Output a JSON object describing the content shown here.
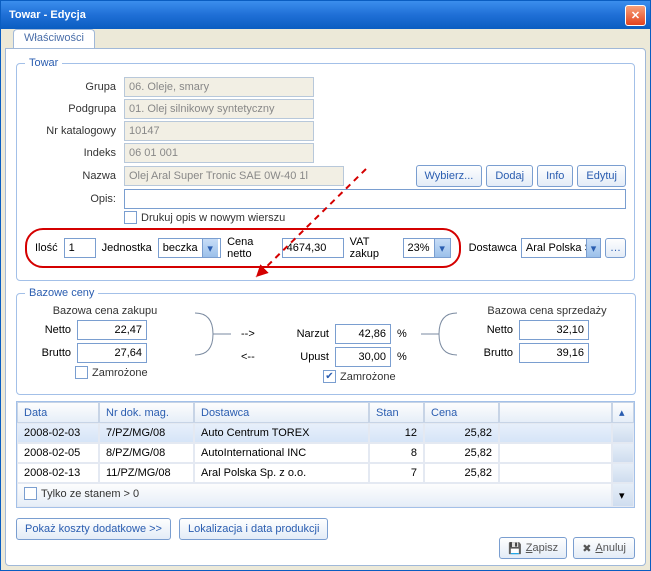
{
  "title": "Towar - Edycja",
  "tab": "Właściwości",
  "groupbox_towar": "Towar",
  "fields": {
    "grupa_lbl": "Grupa",
    "grupa_val": "06. Oleje, smary",
    "podgrupa_lbl": "Podgrupa",
    "podgrupa_val": "01. Olej silnikowy syntetyczny",
    "nrkat_lbl": "Nr katalogowy",
    "nrkat_val": "10147",
    "indeks_lbl": "Indeks",
    "indeks_val": "06 01 001",
    "nazwa_lbl": "Nazwa",
    "nazwa_val": "Olej Aral Super Tronic SAE 0W-40 1l",
    "opis_lbl": "Opis:",
    "opis_val": "",
    "drukuj_chk": "Drukuj opis w nowym wierszu"
  },
  "btns": {
    "wybierz": "Wybierz...",
    "dodaj": "Dodaj",
    "info": "Info",
    "edytuj": "Edytuj"
  },
  "line": {
    "ilosc_lbl": "Ilość",
    "ilosc_val": "1",
    "jedn_lbl": "Jednostka",
    "jedn_val": "beczka",
    "cena_lbl": "Cena netto",
    "cena_val": "4674,30",
    "vat_lbl": "VAT zakup",
    "vat_val": "23%",
    "dost_lbl": "Dostawca",
    "dost_val": "Aral Polska S"
  },
  "bc": {
    "legend": "Bazowe ceny",
    "zakup_title": "Bazowa cena zakupu",
    "sprz_title": "Bazowa cena sprzedaży",
    "netto": "Netto",
    "brutto": "Brutto",
    "z_netto": "22,47",
    "z_brutto": "27,64",
    "narzut_lbl": "Narzut",
    "narzut_arrow": "-->",
    "narzut_val": "42,86",
    "upust_lbl": "Upust",
    "upust_arrow": "<--",
    "upust_val": "30,00",
    "pct": "%",
    "s_netto": "32,10",
    "s_brutto": "39,16",
    "zamrozone": "Zamrożone"
  },
  "grid": {
    "cols": [
      "Data",
      "Nr dok. mag.",
      "Dostawca",
      "Stan",
      "Cena",
      ""
    ],
    "rows": [
      {
        "data": "2008-02-03",
        "nr": "7/PZ/MG/08",
        "dost": "Auto Centrum TOREX",
        "stan": "12",
        "cena": "25,82"
      },
      {
        "data": "2008-02-05",
        "nr": "8/PZ/MG/08",
        "dost": "AutoInternational INC",
        "stan": "8",
        "cena": "25,82"
      },
      {
        "data": "2008-02-13",
        "nr": "11/PZ/MG/08",
        "dost": "Aral Polska Sp. z o.o.",
        "stan": "7",
        "cena": "25,82"
      }
    ],
    "tylko": "Tylko ze stanem > 0"
  },
  "bottom": {
    "koszty": "Pokaż koszty dodatkowe >>",
    "lokal": "Lokalizacja i data produkcji",
    "zapisz": "Zapisz",
    "anuluj": "Anuluj"
  }
}
